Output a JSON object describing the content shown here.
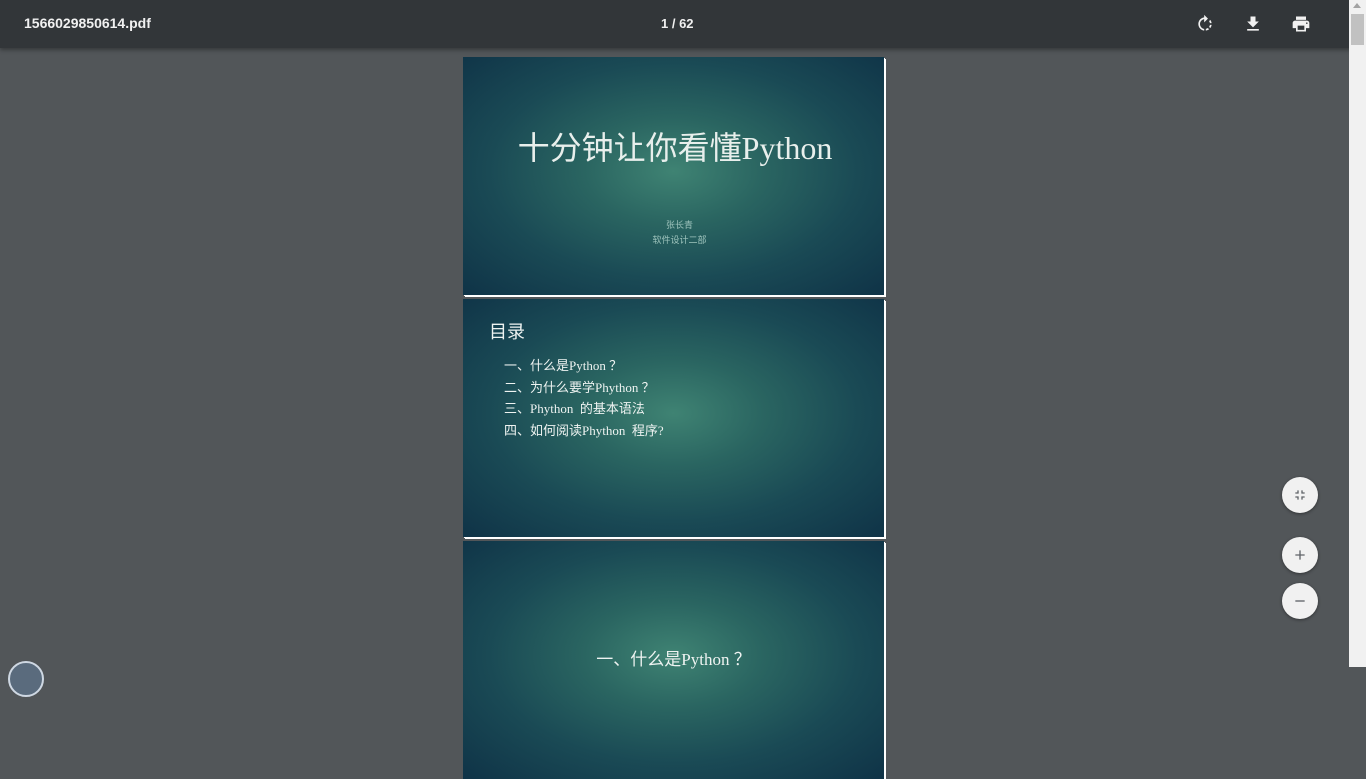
{
  "toolbar": {
    "file_name": "1566029850614.pdf",
    "page_indicator": "1 / 62",
    "icons": {
      "rotate": "rotate-icon",
      "download": "download-icon",
      "print": "print-icon"
    }
  },
  "pages": {
    "page1": {
      "title": "十分钟让你看懂Python",
      "author": "张长青",
      "department": "软件设计二部"
    },
    "page2": {
      "title": "目录",
      "items": [
        "一、什么是Python ？",
        "二、为什么要学Phython ？",
        "三、Phython  的基本语法",
        "四、如何阅读Phython  程序?"
      ]
    },
    "page3": {
      "title": "一、什么是Python ？"
    }
  },
  "zoom_controls": {
    "fit": "fit-to-page-icon",
    "zoom_in": "zoom-in-icon",
    "zoom_out": "zoom-out-icon"
  },
  "colors": {
    "toolbar": "#323639",
    "viewer_background": "#525659",
    "slide_center": "#3f8373",
    "slide_edge": "#0f3347"
  }
}
